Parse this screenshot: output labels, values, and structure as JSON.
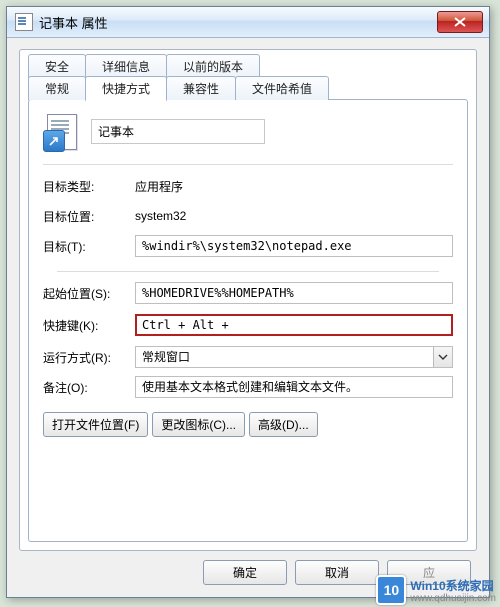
{
  "window": {
    "title": "记事本 属性"
  },
  "tabs_row1": [
    {
      "label": "安全"
    },
    {
      "label": "详细信息"
    },
    {
      "label": "以前的版本"
    }
  ],
  "tabs_row2": [
    {
      "label": "常规"
    },
    {
      "label": "快捷方式",
      "active": true
    },
    {
      "label": "兼容性"
    },
    {
      "label": "文件哈希值"
    }
  ],
  "app": {
    "name": "记事本"
  },
  "fields": {
    "target_type_label": "目标类型:",
    "target_type_value": "应用程序",
    "target_loc_label": "目标位置:",
    "target_loc_value": "system32",
    "target_label": "目标(T):",
    "target_value": "%windir%\\system32\\notepad.exe",
    "startin_label": "起始位置(S):",
    "startin_value": "%HOMEDRIVE%%HOMEPATH%",
    "shortcut_label": "快捷键(K):",
    "shortcut_value": "Ctrl + Alt +",
    "runmode_label": "运行方式(R):",
    "runmode_value": "常规窗口",
    "comment_label": "备注(O):",
    "comment_value": "使用基本文本格式创建和编辑文本文件。"
  },
  "buttons": {
    "open_loc": "打开文件位置(F)",
    "change_icon": "更改图标(C)...",
    "advanced": "高级(D)...",
    "ok": "确定",
    "cancel": "取消",
    "apply": "应"
  },
  "brand": {
    "icon_text": "10",
    "line1": "Win10系统家园",
    "line2": "www.qdhuaijin.com"
  }
}
